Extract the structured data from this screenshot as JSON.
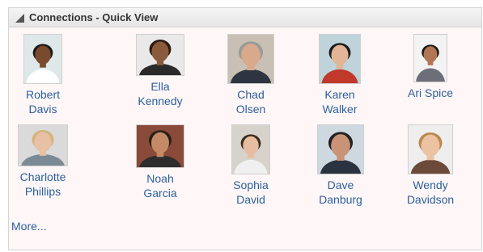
{
  "panel": {
    "title": "Connections - Quick View",
    "more_label": "More..."
  },
  "people": [
    {
      "first": "Robert",
      "last": "Davis",
      "skin": "#7a4a2e",
      "hair": "#1a1a1a",
      "bg": "#dfe8e8",
      "shirt": "#ffffff"
    },
    {
      "first": "Ella",
      "last": "Kennedy",
      "skin": "#8a5a3c",
      "hair": "#2a1a12",
      "bg": "#e9e9e9",
      "shirt": "#2a2a2a"
    },
    {
      "first": "Chad",
      "last": "Olsen",
      "skin": "#d9a98c",
      "hair": "#9a9a9a",
      "bg": "#c8c0b4",
      "shirt": "#2f3540"
    },
    {
      "first": "Karen",
      "last": "Walker",
      "skin": "#e2b596",
      "hair": "#1d1d1d",
      "bg": "#bfd4da",
      "shirt": "#c0392b"
    },
    {
      "first": "Ari Spice",
      "last": "",
      "skin": "#b07656",
      "hair": "#1a1a1a",
      "bg": "#f3f3f3",
      "shirt": "#6e6e78"
    },
    {
      "first": "Charlotte",
      "last": "Phillips",
      "skin": "#e8c0a5",
      "hair": "#d6b37a",
      "bg": "#dadada",
      "shirt": "#7b8a95"
    },
    {
      "first": "Noah",
      "last": "Garcia",
      "skin": "#c48a66",
      "hair": "#2a1f18",
      "bg": "#8a4a3a",
      "shirt": "#2c2c2c"
    },
    {
      "first": "Sophia",
      "last": "David",
      "skin": "#e6bda0",
      "hair": "#3a2a1e",
      "bg": "#d7d2cc",
      "shirt": "#f0f0f0"
    },
    {
      "first": "Dave",
      "last": "Danburg",
      "skin": "#c99377",
      "hair": "#222222",
      "bg": "#cdd8e0",
      "shirt": "#2a3340"
    },
    {
      "first": "Wendy",
      "last": "Davidson",
      "skin": "#ecc2a3",
      "hair": "#b98a4f",
      "bg": "#eeeeee",
      "shirt": "#6b4a3a"
    }
  ]
}
